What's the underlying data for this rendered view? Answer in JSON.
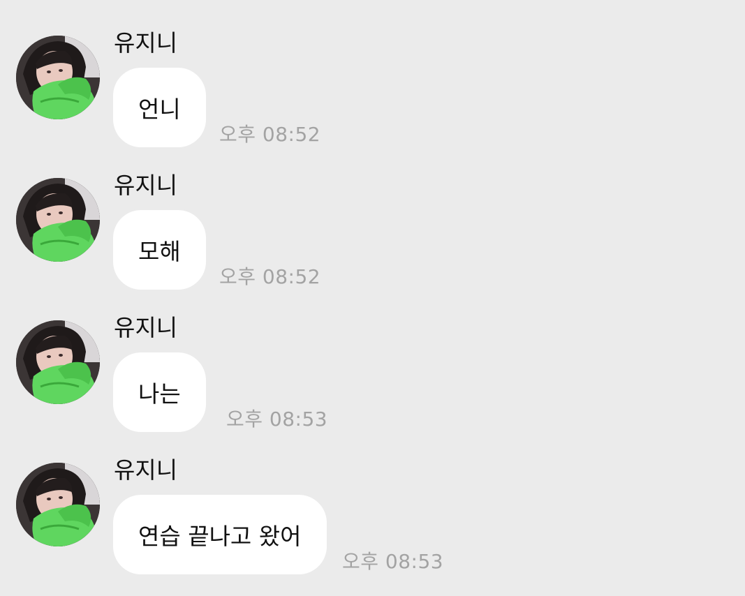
{
  "chat": {
    "background_color": "#ebebeb",
    "bubble_color": "#ffffff",
    "time_color": "#a3a3a3",
    "messages": [
      {
        "sender": "유지니",
        "text": "언니",
        "time": "오후 08:52",
        "avatar_icon": "profile-photo"
      },
      {
        "sender": "유지니",
        "text": "모해",
        "time": "오후 08:52",
        "avatar_icon": "profile-photo"
      },
      {
        "sender": "유지니",
        "text": "나는",
        "time": "오후 08:53",
        "avatar_icon": "profile-photo"
      },
      {
        "sender": "유지니",
        "text": "연습 끝나고 왔어",
        "time": "오후 08:53",
        "avatar_icon": "profile-photo"
      }
    ]
  }
}
